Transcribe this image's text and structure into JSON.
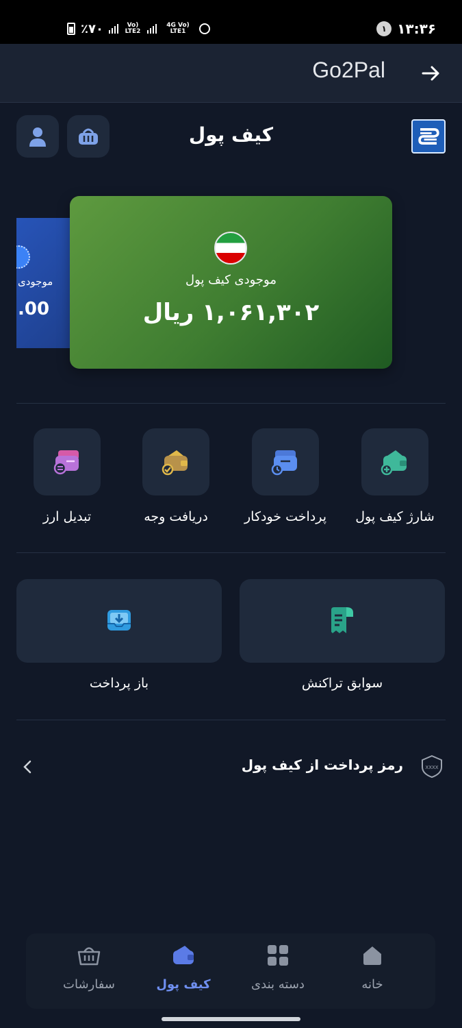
{
  "status_bar": {
    "battery": "٪۷۰",
    "sim1_tag": "Vo) LTE2",
    "sim2_tag": "4G Vo) LTE1",
    "notification_count": "۱",
    "time": "۱۳:۳۶"
  },
  "app_bar": {
    "title": "Go2Pal"
  },
  "header": {
    "title": "کیف پول"
  },
  "cards": {
    "blue": {
      "label": "موجودی",
      "amount": ".00"
    },
    "green": {
      "label": "موجودی کیف پول",
      "amount": "۱,۰۶۱,۳۰۲ ریال"
    }
  },
  "quick_actions": [
    {
      "label": "شارژ کیف پول"
    },
    {
      "label": "پرداخت خودکار"
    },
    {
      "label": "دریافت وجه"
    },
    {
      "label": "تبدیل ارز"
    }
  ],
  "big_tiles": [
    {
      "label": "سوابق تراکنش"
    },
    {
      "label": "باز پرداخت"
    }
  ],
  "pin_row": {
    "label": "رمز پرداخت از کیف پول",
    "icon_text": "XXXX"
  },
  "bottom_nav": [
    {
      "label": "خانه"
    },
    {
      "label": "دسته بندی"
    },
    {
      "label": "کیف پول"
    },
    {
      "label": "سفارشات"
    }
  ],
  "colors": {
    "background": "#111827",
    "tile": "#1f2a3c",
    "card_green": "#3f7d31",
    "card_blue": "#2754b8",
    "nav_active": "#6f8ff0"
  }
}
